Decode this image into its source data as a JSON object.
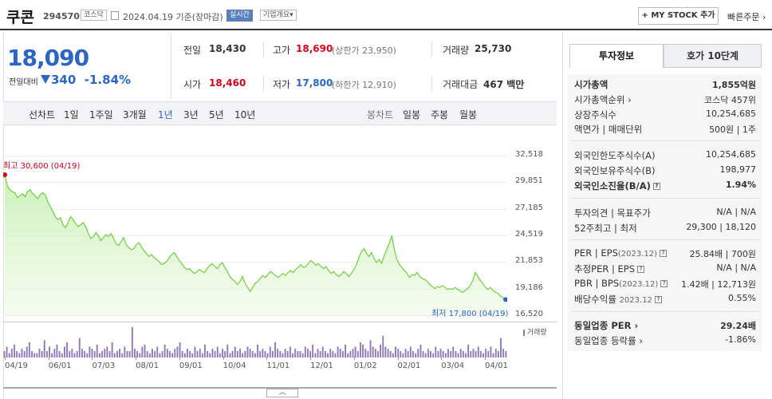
{
  "header": {
    "name": "쿠콘",
    "code": "294570",
    "market": "코스닥",
    "date": "2024.04.19",
    "basis": "기준(장마감)",
    "live_badge": "실시간",
    "corp_overview": "기업개요",
    "corp_overview_arrow": "▾",
    "my_stock_btn": "+ MY STOCK 추가",
    "quick_order": "빠른주문",
    "quick_order_arrow": "›"
  },
  "price": {
    "current": "18,090",
    "change_label": "전일대비",
    "change_arrow": "▼",
    "change": "340",
    "change_pct": "-1.84%"
  },
  "stats": {
    "prev_label": "전일",
    "prev": "18,430",
    "open_label": "시가",
    "open": "18,460",
    "high_label": "고가",
    "high": "18,690",
    "upper_limit": "(상한가 23,950)",
    "low_label": "저가",
    "low": "17,800",
    "lower_limit": "(하한가 12,910)",
    "volume_label": "거래량",
    "volume": "25,730",
    "amount_label": "거래대금",
    "amount": "467 백만"
  },
  "period_bar": {
    "line_label": "선차트",
    "periods": [
      "1일",
      "1주일",
      "3개월",
      "1년",
      "3년",
      "5년",
      "10년"
    ],
    "selected_index": 3,
    "candle_label": "봉차트",
    "candles": [
      "일봉",
      "주봉",
      "월봉"
    ]
  },
  "chart_data": {
    "type": "area",
    "ytick_labels": [
      "32,518",
      "29,851",
      "27,185",
      "24,519",
      "21,853",
      "19,186",
      "16,520"
    ],
    "ylim": [
      16520,
      32518
    ],
    "xtick_labels": [
      "04/19",
      "06/01",
      "07/03",
      "08/01",
      "09/01",
      "10/04",
      "11/01",
      "12/01",
      "01/02",
      "02/01",
      "03/04",
      "04/01"
    ],
    "max_annotation": "최고 30,600 (04/19)",
    "min_annotation": "최저 17,800 (04/19)",
    "volume_label": "거래량",
    "series": [
      {
        "values": [
          30600,
          29500,
          29100,
          28900,
          28800,
          28300,
          28500,
          28700,
          28400,
          28900,
          29100,
          28700,
          28500,
          28200,
          28600,
          28800,
          28600,
          27900,
          27400,
          26900,
          26400,
          26100,
          26300,
          25600,
          25300,
          25800,
          26400,
          26100,
          25700,
          25400,
          25600,
          25800,
          25400,
          24700,
          24200,
          24400,
          24800,
          24500,
          24000,
          24300,
          24600,
          24400,
          24700,
          24200,
          23700,
          23500,
          23900,
          24300,
          23600,
          23300,
          23100,
          23200,
          23600,
          23800,
          23400,
          23000,
          22700,
          22400,
          22600,
          22300,
          22100,
          21900,
          21600,
          21700,
          21900,
          22300,
          22600,
          22800,
          22400,
          22000,
          21700,
          21300,
          21100,
          21200,
          20900,
          20700,
          20900,
          21100,
          20900,
          20800,
          21200,
          21500,
          21700,
          21400,
          21200,
          21600,
          21800,
          21300,
          20900,
          20400,
          20100,
          19900,
          19600,
          19900,
          20400,
          19700,
          19300,
          18900,
          19300,
          19700,
          19900,
          20200,
          20500,
          20300,
          20600,
          20900,
          20700,
          20500,
          20300,
          20500,
          20700,
          20500,
          20800,
          21000,
          20800,
          21100,
          21300,
          21600,
          21300,
          21400,
          21700,
          22000,
          21800,
          21500,
          21700,
          21400,
          21200,
          21400,
          21000,
          20700,
          20900,
          20600,
          20400,
          20600,
          20900,
          20700,
          20400,
          20700,
          21100,
          21600,
          22300,
          22900,
          23200,
          22700,
          22400,
          22800,
          22200,
          21800,
          22100,
          21700,
          22500,
          23100,
          23700,
          24500,
          23100,
          22100,
          21600,
          21300,
          21000,
          20700,
          20300,
          20600,
          20500,
          20800,
          20400,
          20200,
          20100,
          19900,
          19600,
          19400,
          19200,
          19400,
          19300,
          19500,
          19300,
          19100,
          19200,
          19100,
          19300,
          19100,
          19000,
          18800,
          19000,
          19200,
          19500,
          20000,
          20800,
          20400,
          20000,
          19700,
          19300,
          19100,
          19300,
          19000,
          18800,
          18700,
          18400,
          18300,
          18090
        ]
      }
    ],
    "volume": [
      3,
      5,
      2,
      4,
      6,
      3,
      2,
      4,
      3,
      5,
      7,
      3,
      2,
      2,
      4,
      3,
      8,
      3,
      5,
      2,
      4,
      6,
      3,
      2,
      5,
      7,
      3,
      4,
      2,
      3,
      9,
      4,
      3,
      2,
      5,
      4,
      3,
      6,
      2,
      3,
      4,
      5,
      3,
      7,
      2,
      3,
      4,
      2,
      5,
      3,
      3,
      14,
      4,
      3,
      2,
      5,
      6,
      3,
      2,
      4,
      3,
      5,
      2,
      3,
      6,
      4,
      3,
      2,
      4,
      5,
      7,
      3,
      2,
      4,
      3,
      2,
      5,
      3,
      4,
      2,
      6,
      3,
      2,
      4,
      3,
      5,
      2,
      4,
      3,
      6,
      2,
      3,
      5,
      3,
      4,
      2,
      3,
      5,
      4,
      3,
      2,
      6,
      3,
      4,
      3,
      2,
      5,
      3,
      7,
      4,
      3,
      2,
      4,
      3,
      5,
      2,
      4,
      3,
      3,
      2,
      5,
      4,
      3,
      6,
      2,
      4,
      3,
      5,
      3,
      2,
      4,
      3,
      2,
      5,
      4,
      3,
      6,
      2,
      3,
      4,
      5,
      3,
      7,
      6,
      4,
      3,
      8,
      5,
      4,
      3,
      6,
      10,
      5,
      4,
      3,
      2,
      5,
      4,
      3,
      2,
      4,
      3,
      5,
      3,
      2,
      4,
      6,
      3,
      2,
      4,
      3,
      2,
      5,
      3,
      4,
      3,
      2,
      4,
      3,
      5,
      3,
      2,
      4,
      3,
      2,
      6,
      3,
      4,
      3,
      5,
      3,
      2,
      4,
      3,
      5,
      2,
      4,
      3,
      9,
      4,
      3
    ]
  },
  "right_panel": {
    "tab_invest": "투자정보",
    "tab_orderbook": "호가 10단계",
    "market_cap_label": "시가총액",
    "market_cap": "1,855억원",
    "market_cap_rank_label": "시가총액순위",
    "market_cap_rank_arrow": "›",
    "market_cap_rank": "코스닥 457위",
    "shares_label": "상장주식수",
    "shares": "10,254,685",
    "par_label": "액면가 | 매매단위",
    "par": "500원 | 1주",
    "foreign_limit_label": "외국인한도주식수(A)",
    "foreign_limit": "10,254,685",
    "foreign_hold_label": "외국인보유주식수(B)",
    "foreign_hold": "198,977",
    "foreign_ratio_label": "외국인소진율(B/A)",
    "foreign_ratio": "1.94%",
    "opinion_label": "투자의견 | 목표주가",
    "opinion": "N/A | N/A",
    "week52_label": "52주최고 | 최저",
    "week52": "29,300 | 18,120",
    "per_label": "PER | EPS",
    "per_period": "(2023.12)",
    "per": "25.84배 | 700원",
    "est_per_label": "추정PER | EPS",
    "est_per": "N/A | N/A",
    "pbr_label": "PBR | BPS",
    "pbr_period": "(2023.12)",
    "pbr": "1.42배 | 12,713원",
    "div_label": "배당수익률",
    "div_period": "2023.12",
    "div": "0.55%",
    "sector_per_label": "동일업종 PER",
    "sector_per_arrow": "›",
    "sector_per": "29.24배",
    "sector_change_label": "동일업종 등락률",
    "sector_change_arrow": "›",
    "sector_change": "-1.86%",
    "help_icon_glyph": "?"
  },
  "footer": {
    "collapse_glyph": "︿"
  },
  "colors": {
    "up": "#d0021b",
    "down": "#2b66c3",
    "line": "#6fcf3f"
  }
}
